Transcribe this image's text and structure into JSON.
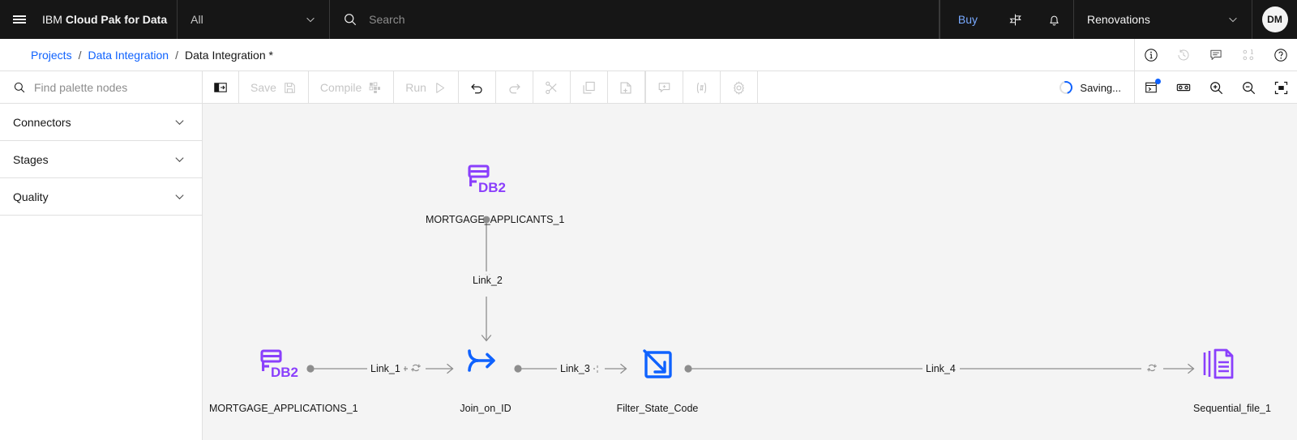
{
  "header": {
    "menu_icon": "hamburger-menu-icon",
    "brand_light": "IBM",
    "brand_bold": "Cloud Pak for Data",
    "scope_value": "All",
    "scope_caret": "chevron-down-icon",
    "search_icon": "search-icon",
    "search_placeholder": "Search",
    "search_value": "",
    "buy_label": "Buy",
    "signpost_icon": "signpost-icon",
    "bell_icon": "notification-bell-icon",
    "tenant_name": "Renovations",
    "tenant_caret": "chevron-down-icon",
    "avatar_initials": "DM"
  },
  "breadcrumb": {
    "items": [
      {
        "label": "Projects",
        "link": true
      },
      {
        "label": "Data Integration",
        "link": true
      },
      {
        "label": "Data Integration *",
        "link": false
      }
    ],
    "separator": "/",
    "actions": [
      {
        "name": "info-icon",
        "label": "Information",
        "active": true
      },
      {
        "name": "history-icon",
        "label": "History",
        "active": false
      },
      {
        "name": "comment-icon",
        "label": "Comments",
        "active": true
      },
      {
        "name": "lineage-icon",
        "label": "Lineage",
        "active": false
      },
      {
        "name": "help-icon",
        "label": "Help",
        "active": true
      }
    ]
  },
  "palette": {
    "search_icon": "search-icon",
    "search_placeholder": "Find palette nodes",
    "search_value": "",
    "categories": [
      {
        "label": "Connectors",
        "caret": "chevron-down-icon"
      },
      {
        "label": "Stages",
        "caret": "chevron-down-icon"
      },
      {
        "label": "Quality",
        "caret": "chevron-down-icon"
      }
    ]
  },
  "toolbar": {
    "panel_toggle": "show-palette-icon",
    "save_label": "Save",
    "save_icon": "save-disk-icon",
    "compile_label": "Compile",
    "compile_icon": "compile-icon",
    "run_label": "Run",
    "run_icon": "play-triangle-icon",
    "undo_icon": "undo-icon",
    "redo_icon": "redo-icon",
    "cut_icon": "scissors-cut-icon",
    "copy_icon": "copy-icon",
    "paste_icon": "paste-icon",
    "comment_icon": "add-comment-icon",
    "parameters_icon": "parameters-hash-icon",
    "settings_icon": "gear-settings-icon",
    "status_text": "Saving...",
    "status_spinner": "loading-spinner-icon",
    "open_panel_icon": "open-side-panel-icon",
    "open_panel_badge": true,
    "overview_icon": "overview-pan-icon",
    "zoom_in_icon": "zoom-in-icon",
    "zoom_out_icon": "zoom-out-icon",
    "zoom_fit_icon": "zoom-to-fit-icon"
  },
  "canvas": {
    "nodes": [
      {
        "id": "mortgage_applicants",
        "label": "MORTGAGE_APPLICANTS_1",
        "icon": "db2-database-icon",
        "color": "#8a3ffc"
      },
      {
        "id": "mortgage_applications",
        "label": "MORTGAGE_APPLICATIONS_1",
        "icon": "db2-database-icon",
        "color": "#8a3ffc"
      },
      {
        "id": "join_on_id",
        "label": "Join_on_ID",
        "icon": "join-merge-icon",
        "color": "#0f62fe"
      },
      {
        "id": "filter_state_code",
        "label": "Filter_State_Code",
        "icon": "transform-arrow-icon",
        "color": "#0f62fe"
      },
      {
        "id": "sequential_file",
        "label": "Sequential_file_1",
        "icon": "sequential-file-icon",
        "color": "#8a3ffc"
      }
    ],
    "links": [
      {
        "id": "link_1",
        "label": "Link_1",
        "sync_icon": "sync-refresh-icon"
      },
      {
        "id": "link_2",
        "label": "Link_2",
        "sync_icon": "sync-refresh-icon"
      },
      {
        "id": "link_3",
        "label": "Link_3",
        "sync_icon": "sync-refresh-icon"
      },
      {
        "id": "link_4",
        "label": "Link_4",
        "sync_icon": "sync-refresh-icon"
      }
    ]
  }
}
